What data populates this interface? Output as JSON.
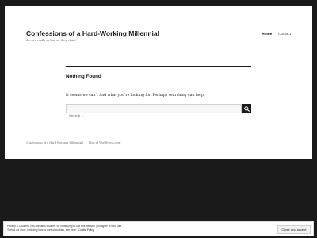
{
  "header": {
    "site_title": "Confessions of a Hard-Working Millennial",
    "tagline": "Are we really as bad as they claim?",
    "nav": [
      {
        "label": "Home"
      },
      {
        "label": "Contact"
      }
    ]
  },
  "main": {
    "heading": "Nothing Found",
    "message": "It seems we can’t find what you’re looking for. Perhaps searching can help.",
    "search": {
      "placeholder": "Search …",
      "value": ""
    }
  },
  "footer": {
    "site_link": "Confessions of a Hard-Working Millennial",
    "credit": "Blog at WordPress.com."
  },
  "cookie_notice": {
    "line1": "Privacy & Cookies: This site uses cookies. By continuing to use this website, you agree to their use.",
    "line2": "To find out more, including how to control cookies, see here:",
    "link": "Cookie Policy",
    "button": "Close and accept"
  },
  "icons": {
    "search_button": "search-icon"
  },
  "colors": {
    "background": "#1a1a1a",
    "page": "#ffffff",
    "text": "#1a1a1a",
    "muted": "#707070"
  }
}
